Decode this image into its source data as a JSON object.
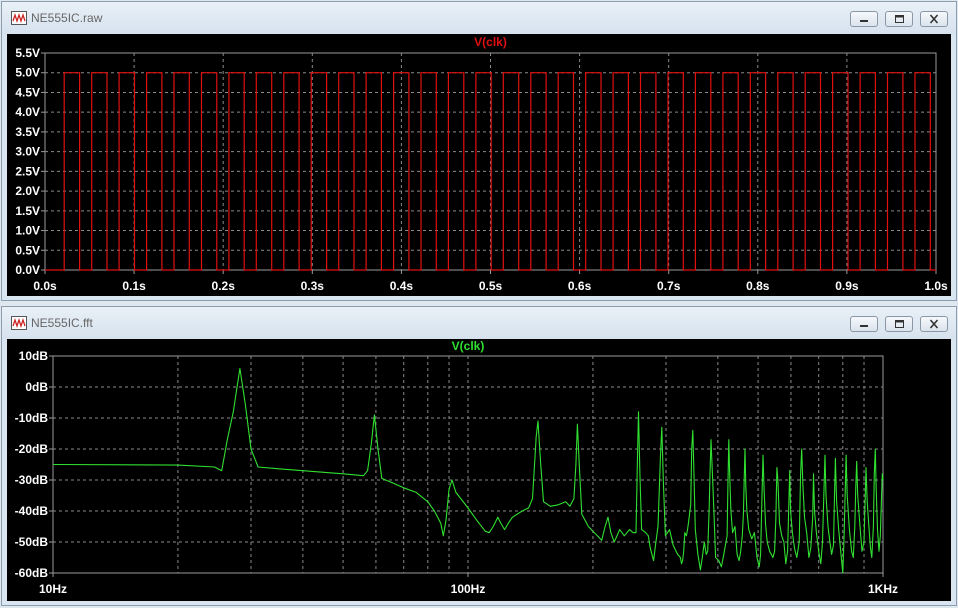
{
  "windows": [
    {
      "title": "NE555IC.raw",
      "chart_data": {
        "type": "line",
        "title": "V(clk)",
        "trace_color": "#e01010",
        "x_scale": "linear",
        "xlim": [
          0,
          1.0
        ],
        "ylim": [
          0,
          5.5
        ],
        "x_ticks": [
          "0.0s",
          "0.1s",
          "0.2s",
          "0.3s",
          "0.4s",
          "0.5s",
          "0.6s",
          "0.7s",
          "0.8s",
          "0.9s",
          "1.0s"
        ],
        "y_ticks": [
          "0.0V",
          "0.5V",
          "1.0V",
          "1.5V",
          "2.0V",
          "2.5V",
          "3.0V",
          "3.5V",
          "4.0V",
          "4.5V",
          "5.0V",
          "5.5V"
        ],
        "grid": true,
        "series": [
          {
            "name": "V(clk)",
            "waveform": "square",
            "low": 0.0,
            "high": 5.0,
            "first_rise": 0.0216,
            "period": 0.0308,
            "high_time": 0.0172
          }
        ]
      }
    },
    {
      "title": "NE555IC.fft",
      "chart_data": {
        "type": "line",
        "title": "V(clk)",
        "trace_color": "#30e030",
        "x_scale": "log",
        "xlim": [
          10,
          1000
        ],
        "ylim": [
          -60,
          10
        ],
        "x_ticks": [
          "10Hz",
          "100Hz",
          "1KHz"
        ],
        "y_ticks": [
          "10dB",
          "0dB",
          "-10dB",
          "-20dB",
          "-30dB",
          "-40dB",
          "-50dB",
          "-60dB"
        ],
        "grid": true,
        "series": [
          {
            "name": "V(clk)",
            "points": [
              [
                10,
                -25
              ],
              [
                20,
                -25.2
              ],
              [
                24.5,
                -25.8
              ],
              [
                25.5,
                -27
              ],
              [
                26.3,
                -17
              ],
              [
                27.2,
                -8
              ],
              [
                28.2,
                6
              ],
              [
                29.1,
                -6
              ],
              [
                30.0,
                -20
              ],
              [
                31.2,
                -25.8
              ],
              [
                35,
                -26.4
              ],
              [
                40,
                -27
              ],
              [
                50,
                -28
              ],
              [
                56,
                -28.6
              ],
              [
                57.3,
                -27
              ],
              [
                58.5,
                -18
              ],
              [
                59.5,
                -9
              ],
              [
                60.7,
                -20
              ],
              [
                62,
                -29.5
              ],
              [
                66,
                -31
              ],
              [
                70,
                -32.5
              ],
              [
                75,
                -34
              ],
              [
                80,
                -37
              ],
              [
                83,
                -40
              ],
              [
                86,
                -44
              ],
              [
                87.2,
                -48
              ],
              [
                88.5,
                -43
              ],
              [
                90,
                -33
              ],
              [
                91.5,
                -30
              ],
              [
                93.5,
                -34
              ],
              [
                100,
                -39
              ],
              [
                105,
                -43
              ],
              [
                110,
                -46.5
              ],
              [
                112.5,
                -47
              ],
              [
                115,
                -45
              ],
              [
                118,
                -42
              ],
              [
                120,
                -44
              ],
              [
                122.5,
                -46
              ],
              [
                125,
                -44
              ],
              [
                128,
                -42
              ],
              [
                135,
                -40
              ],
              [
                140,
                -39
              ],
              [
                143,
                -36
              ],
              [
                146,
                -16
              ],
              [
                147.5,
                -11
              ],
              [
                149.5,
                -24
              ],
              [
                152,
                -37
              ],
              [
                158,
                -38.5
              ],
              [
                165,
                -38
              ],
              [
                172,
                -37
              ],
              [
                176,
                -38.5
              ],
              [
                180,
                -36
              ],
              [
                182,
                -25
              ],
              [
                183.5,
                -12
              ],
              [
                185.5,
                -26
              ],
              [
                188,
                -41
              ],
              [
                195,
                -45
              ],
              [
                200,
                -46.5
              ],
              [
                205,
                -48
              ],
              [
                210,
                -49.5
              ],
              [
                214,
                -45
              ],
              [
                217.5,
                -42
              ],
              [
                221,
                -47
              ],
              [
                225,
                -50
              ],
              [
                232,
                -46
              ],
              [
                238,
                -48
              ],
              [
                245,
                -46
              ],
              [
                250,
                -47
              ],
              [
                254,
                -47
              ],
              [
                256,
                -24
              ],
              [
                257.5,
                -8
              ],
              [
                259.5,
                -28
              ],
              [
                262,
                -46
              ],
              [
                268,
                -47
              ],
              [
                272,
                -48
              ],
              [
                275,
                -52
              ],
              [
                280,
                -56
              ],
              [
                283,
                -51
              ],
              [
                287,
                -45
              ],
              [
                291,
                -22
              ],
              [
                293,
                -13
              ],
              [
                295.5,
                -30
              ],
              [
                299,
                -48
              ],
              [
                306,
                -46
              ],
              [
                312,
                -51
              ],
              [
                320,
                -54
              ],
              [
                325,
                -55
              ],
              [
                327,
                -57
              ],
              [
                329,
                -56
              ],
              [
                331,
                -53
              ],
              [
                333,
                -47
              ],
              [
                336,
                -48
              ],
              [
                339,
                -45
              ],
              [
                344,
                -38
              ],
              [
                346,
                -20
              ],
              [
                348,
                -14
              ],
              [
                350,
                -26
              ],
              [
                353,
                -46
              ],
              [
                358,
                -54
              ],
              [
                363,
                -59
              ],
              [
                367,
                -55
              ],
              [
                371,
                -50
              ],
              [
                375,
                -54
              ],
              [
                378,
                -53
              ],
              [
                381,
                -40
              ],
              [
                383,
                -28
              ],
              [
                385,
                -17
              ],
              [
                387,
                -24
              ],
              [
                390,
                -35
              ],
              [
                395,
                -55
              ],
              [
                402,
                -56
              ],
              [
                408,
                -58
              ],
              [
                412,
                -55
              ],
              [
                416,
                -52
              ],
              [
                421,
                -48
              ],
              [
                423,
                -32
              ],
              [
                425,
                -17
              ],
              [
                427,
                -27
              ],
              [
                430,
                -40
              ],
              [
                434,
                -47
              ],
              [
                440,
                -45
              ],
              [
                445,
                -54
              ],
              [
                450,
                -56
              ],
              [
                454,
                -53
              ],
              [
                458,
                -48
              ],
              [
                461,
                -41
              ],
              [
                463,
                -30
              ],
              [
                465,
                -20
              ],
              [
                467,
                -32
              ],
              [
                470,
                -40
              ],
              [
                475,
                -46
              ],
              [
                483,
                -49
              ],
              [
                490,
                -47
              ],
              [
                497,
                -55
              ],
              [
                503,
                -58
              ],
              [
                507,
                -54
              ],
              [
                511,
                -35
              ],
              [
                514,
                -22
              ],
              [
                517,
                -33
              ],
              [
                521,
                -44
              ],
              [
                526,
                -50
              ],
              [
                533,
                -53
              ],
              [
                538,
                -54
              ],
              [
                543,
                -55
              ],
              [
                548,
                -53
              ],
              [
                552,
                -42
              ],
              [
                555,
                -26
              ],
              [
                558,
                -30
              ],
              [
                563,
                -44
              ],
              [
                570,
                -48
              ],
              [
                577,
                -50
              ],
              [
                583,
                -57
              ],
              [
                589,
                -53
              ],
              [
                593,
                -38
              ],
              [
                596,
                -27
              ],
              [
                599,
                -40
              ],
              [
                605,
                -47
              ],
              [
                612,
                -52
              ],
              [
                620,
                -55
              ],
              [
                628,
                -50
              ],
              [
                633,
                -28
              ],
              [
                637,
                -20
              ],
              [
                641,
                -31
              ],
              [
                647,
                -42
              ],
              [
                655,
                -47
              ],
              [
                663,
                -55
              ],
              [
                670,
                -52
              ],
              [
                677,
                -42
              ],
              [
                680,
                -28
              ],
              [
                684,
                -40
              ],
              [
                691,
                -47
              ],
              [
                700,
                -53
              ],
              [
                708,
                -57
              ],
              [
                715,
                -50
              ],
              [
                721,
                -33
              ],
              [
                725,
                -22
              ],
              [
                729,
                -35
              ],
              [
                737,
                -45
              ],
              [
                745,
                -50
              ],
              [
                752,
                -54
              ],
              [
                760,
                -51
              ],
              [
                764,
                -35
              ],
              [
                768,
                -23
              ],
              [
                773,
                -37
              ],
              [
                782,
                -46
              ],
              [
                792,
                -54
              ],
              [
                800,
                -60
              ],
              [
                806,
                -48
              ],
              [
                811,
                -34
              ],
              [
                815,
                -22
              ],
              [
                820,
                -35
              ],
              [
                830,
                -46
              ],
              [
                840,
                -53
              ],
              [
                848,
                -55
              ],
              [
                855,
                -45
              ],
              [
                860,
                -32
              ],
              [
                864,
                -24
              ],
              [
                869,
                -35
              ],
              [
                880,
                -45
              ],
              [
                890,
                -53
              ],
              [
                900,
                -50
              ],
              [
                905,
                -38
              ],
              [
                910,
                -26
              ],
              [
                916,
                -37
              ],
              [
                925,
                -45
              ],
              [
                933,
                -52
              ],
              [
                940,
                -55
              ],
              [
                948,
                -45
              ],
              [
                953,
                -28
              ],
              [
                958,
                -20
              ],
              [
                963,
                -33
              ],
              [
                970,
                -46
              ],
              [
                978,
                -53
              ],
              [
                985,
                -48
              ],
              [
                992,
                -35
              ],
              [
                996,
                -28
              ],
              [
                1000,
                -30
              ]
            ]
          }
        ]
      }
    }
  ]
}
